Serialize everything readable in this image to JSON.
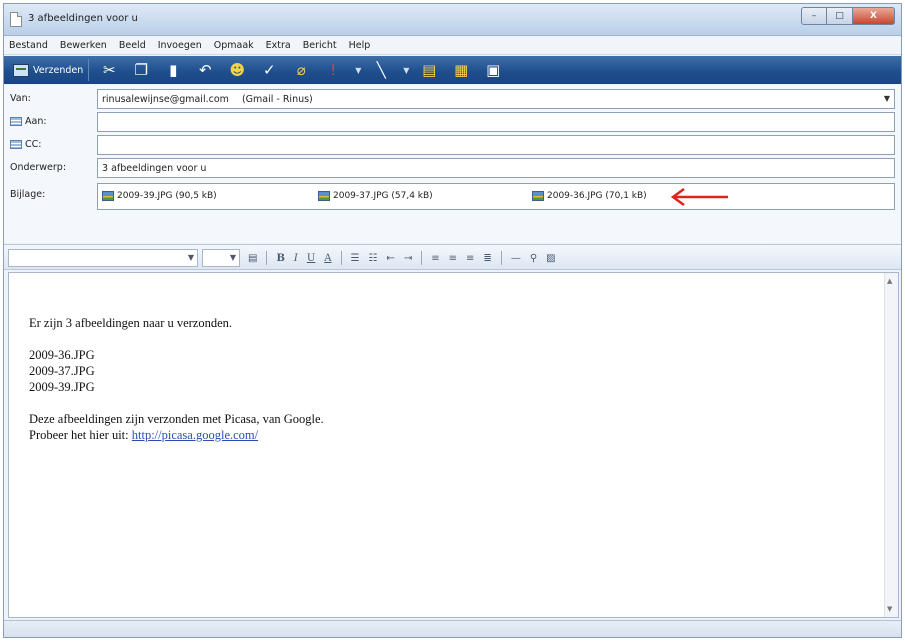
{
  "window": {
    "title": "3 afbeeldingen voor u",
    "controls": {
      "minimize": "–",
      "maximize": "□",
      "close": "X"
    }
  },
  "menu": [
    "Bestand",
    "Bewerken",
    "Beeld",
    "Invoegen",
    "Opmaak",
    "Extra",
    "Bericht",
    "Help"
  ],
  "toolbar": {
    "send_label": "Verzenden",
    "icons": [
      "cut-icon",
      "copy-icon",
      "paste-icon",
      "undo-icon",
      "check-names-icon",
      "spelling-icon",
      "attach-icon",
      "priority-icon",
      "sign-icon",
      "encrypt-icon",
      "offline-icon"
    ]
  },
  "header": {
    "from_label": "Van:",
    "from_email": "rinusalewijnse@gmail.com",
    "from_account": "(Gmail - Rinus)",
    "to_label": "Aan:",
    "to_value": "",
    "cc_label": "CC:",
    "cc_value": "",
    "subject_label": "Onderwerp:",
    "subject_value": "3 afbeeldingen voor u",
    "attach_label": "Bijlage:",
    "attachments": [
      "2009-39.JPG (90,5 kB)",
      "2009-37.JPG (57,4 kB)",
      "2009-36.JPG (70,1 kB)"
    ],
    "annotation_arrow_color": "#e0241b"
  },
  "format_toolbar": {
    "font_value": "",
    "size_value": "",
    "buttons": [
      "B",
      "I",
      "U",
      "A"
    ]
  },
  "body": {
    "intro": "Er zijn 3 afbeeldingen naar u verzonden.",
    "files": [
      "2009-36.JPG",
      "2009-37.JPG",
      "2009-39.JPG"
    ],
    "footer_line1": "Deze afbeeldingen zijn verzonden met Picasa, van Google.",
    "footer_line2": "Probeer het hier uit:",
    "link": "http://picasa.google.com/"
  },
  "colors": {
    "toolbar_blue": "#1f4f8e",
    "link": "#2a4fb0"
  }
}
